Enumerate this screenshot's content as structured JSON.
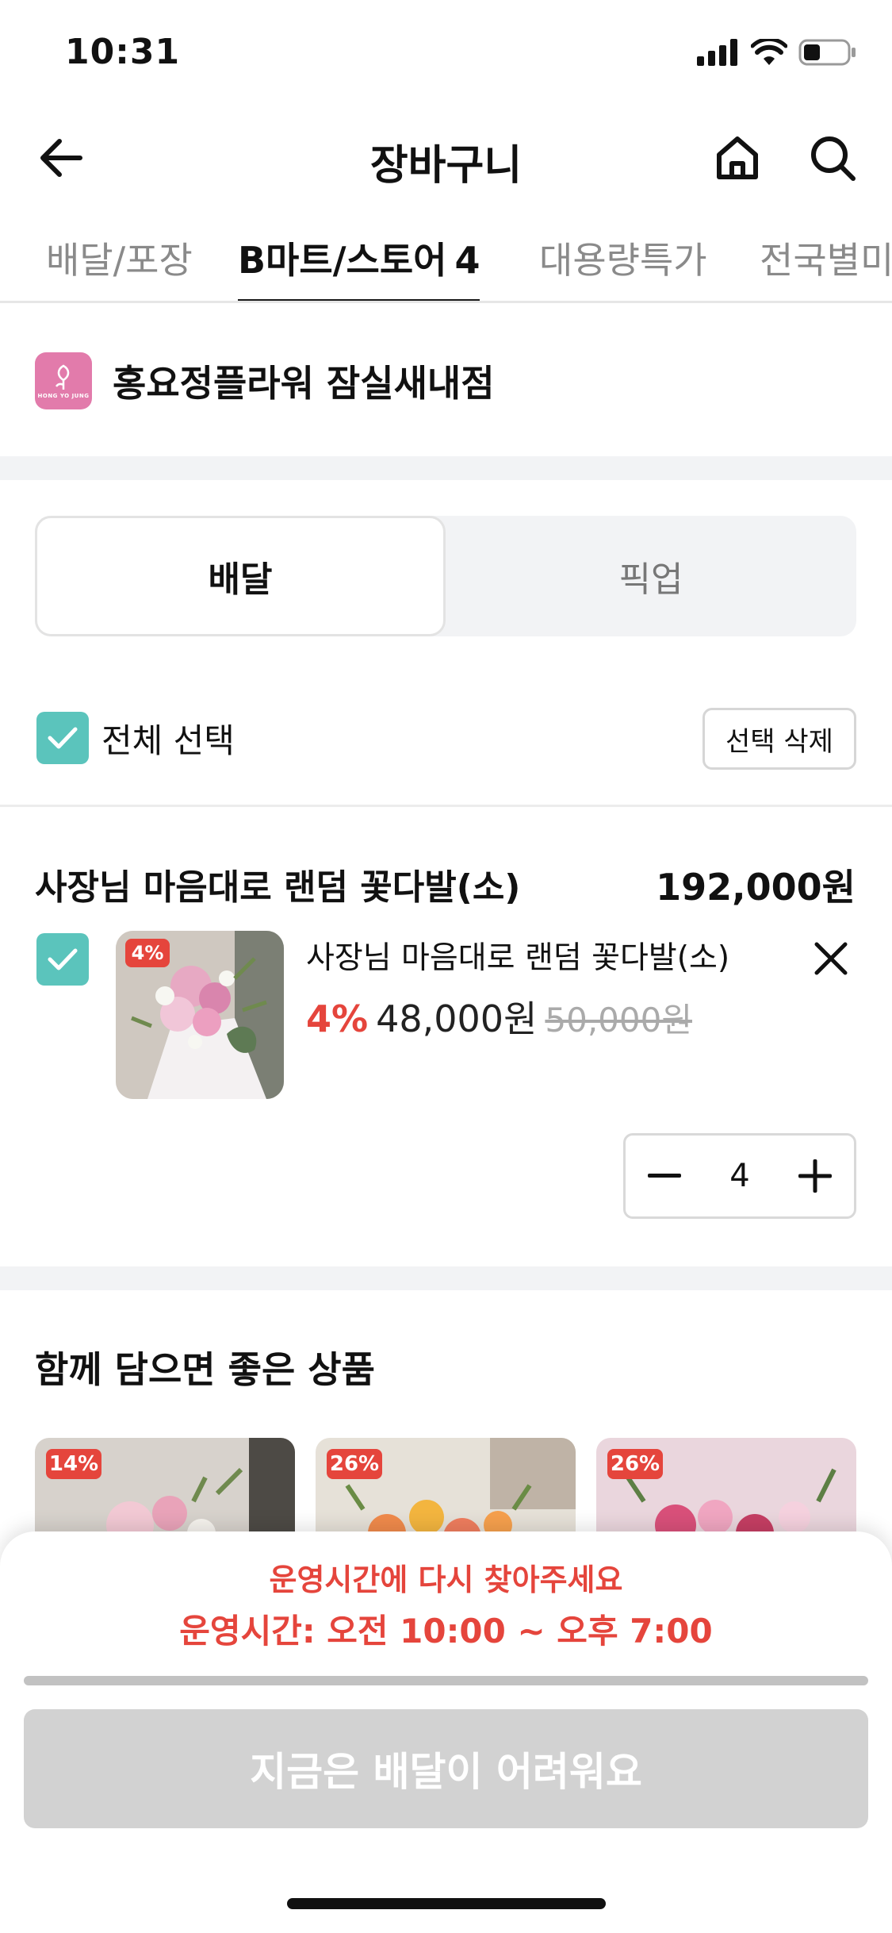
{
  "status_bar": {
    "time": "10:31"
  },
  "header": {
    "title": "장바구니"
  },
  "tabs": [
    {
      "label": "배달/포장",
      "count": ""
    },
    {
      "label": "B마트/스토어",
      "count": "4"
    },
    {
      "label": "대용량특가",
      "count": ""
    },
    {
      "label": "전국별미",
      "count": ""
    }
  ],
  "store": {
    "name": "홍요정플라워 잠실새내점",
    "logo_text": "HONG YO JUNG"
  },
  "mode_toggle": {
    "delivery": "배달",
    "pickup": "픽업",
    "selected": "delivery"
  },
  "selection": {
    "select_all_label": "전체 선택",
    "delete_selected_label": "선택 삭제",
    "all_checked": true
  },
  "group": {
    "title": "사장님 마음대로 랜덤 꽃다발(소)",
    "total": "192,000원",
    "item": {
      "checked": true,
      "badge": "4%",
      "name": "사장님 마음대로 랜덤 꽃다발(소)",
      "discount": "4%",
      "price": "48,000원",
      "original_price": "50,000원",
      "quantity": "4"
    }
  },
  "recommendations": {
    "title": "함께 담으면 좋은 상품",
    "items": [
      {
        "badge": "14%"
      },
      {
        "badge": "26%"
      },
      {
        "badge": "26%"
      }
    ]
  },
  "bottom_sheet": {
    "closed_message": "운영시간에 다시 찾아주세요",
    "hours": "운영시간: 오전 10:00 ~ 오후 7:00",
    "order_button": "지금은 배달이 어려워요"
  },
  "colors": {
    "accent_red": "#e5453c",
    "check_teal": "#5bc4bc",
    "disabled_gray": "#d2d2d2"
  }
}
